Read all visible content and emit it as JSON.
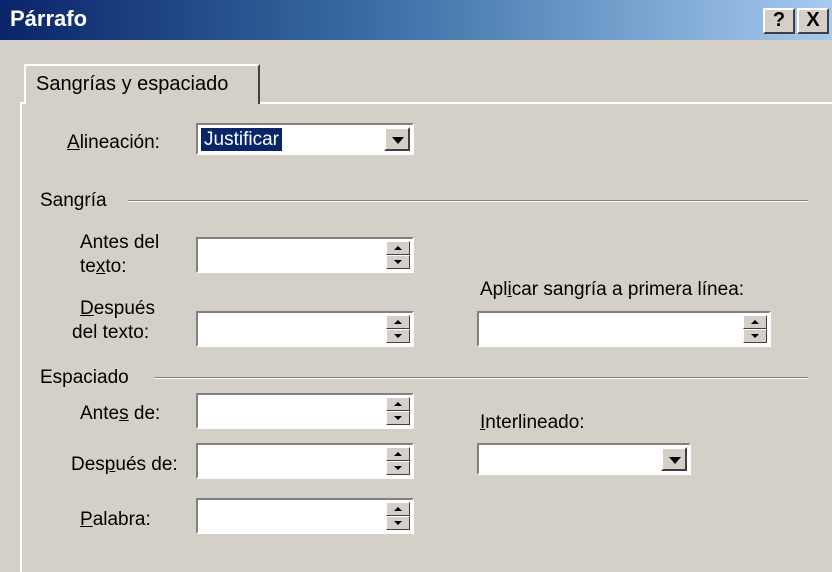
{
  "window": {
    "title": "Párrafo",
    "help_label": "?",
    "close_label": "X"
  },
  "tabs": [
    {
      "label": "Sangrías y espaciado",
      "selected": true
    }
  ],
  "alignment": {
    "label_first": "A",
    "label_rest": "lineación:",
    "value": "Justificar"
  },
  "indent": {
    "section_label": "Sangría",
    "before_line1": "Antes del",
    "before_line2_a": "te",
    "before_line2_u": "x",
    "before_line2_b": "to:",
    "before_value": "",
    "after_line1_u": "D",
    "after_line1_rest": "espués",
    "after_line2": "del texto:",
    "after_value": "",
    "first_line_label_a": "Apl",
    "first_line_label_u": "i",
    "first_line_label_b": "car sangría a primera línea:",
    "first_line_value": ""
  },
  "spacing": {
    "section_label": "Espaciado",
    "before_a": "Ante",
    "before_u": "s",
    "before_b": " de:",
    "before_value": "",
    "after_a": "Des",
    "after_u": "p",
    "after_b": "ués de:",
    "after_value": "",
    "word_u": "P",
    "word_rest": "alabra:",
    "word_value": "",
    "line_u": "I",
    "line_rest": "nterlineado:",
    "line_value": ""
  },
  "colors": {
    "dialog_bg": "#d4d0c8",
    "titlebar_start": "#0a246a",
    "titlebar_end": "#a6caf0",
    "selection": "#0a246a"
  }
}
